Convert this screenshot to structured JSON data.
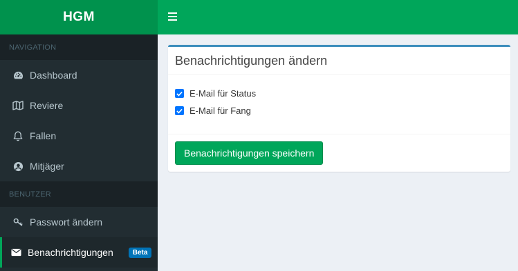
{
  "app": {
    "logo": "HGM"
  },
  "sidebar": {
    "sections": [
      {
        "header": "NAVIGATION",
        "items": [
          {
            "label": "Dashboard",
            "icon": "dashboard-icon"
          },
          {
            "label": "Reviere",
            "icon": "map-icon"
          },
          {
            "label": "Fallen",
            "icon": "bell-icon"
          },
          {
            "label": "Mitjäger",
            "icon": "user-circle-icon"
          }
        ]
      },
      {
        "header": "BENUTZER",
        "items": [
          {
            "label": "Passwort ändern",
            "icon": "key-icon"
          },
          {
            "label": "Benachrichtigungen",
            "icon": "envelope-icon",
            "badge": "Beta",
            "active": true
          }
        ]
      }
    ]
  },
  "topbar": {
    "menu_icon": "hamburger-icon"
  },
  "main": {
    "title": "Benachrichtigungen ändern",
    "options": [
      {
        "label": "E-Mail für Status",
        "checked": true
      },
      {
        "label": "E-Mail für Fang",
        "checked": true
      }
    ],
    "save_label": "Benachrichtigungen speichern"
  },
  "colors": {
    "brand_dark": "#00924d",
    "brand": "#00a65a",
    "sidebar_bg": "#222d32",
    "box_accent": "#3c8dbc",
    "badge": "#0073b7",
    "checkbox": "#0075ff"
  }
}
